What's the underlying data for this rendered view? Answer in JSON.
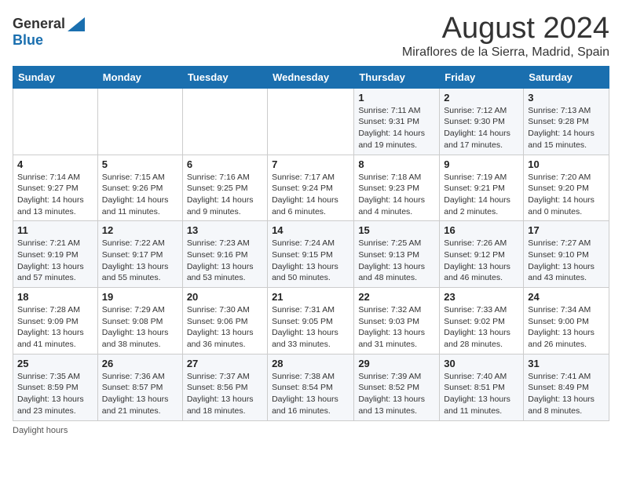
{
  "header": {
    "logo_general": "General",
    "logo_blue": "Blue",
    "main_title": "August 2024",
    "subtitle": "Miraflores de la Sierra, Madrid, Spain"
  },
  "columns": [
    "Sunday",
    "Monday",
    "Tuesday",
    "Wednesday",
    "Thursday",
    "Friday",
    "Saturday"
  ],
  "weeks": [
    [
      {
        "day": "",
        "info": ""
      },
      {
        "day": "",
        "info": ""
      },
      {
        "day": "",
        "info": ""
      },
      {
        "day": "",
        "info": ""
      },
      {
        "day": "1",
        "info": "Sunrise: 7:11 AM\nSunset: 9:31 PM\nDaylight: 14 hours and 19 minutes."
      },
      {
        "day": "2",
        "info": "Sunrise: 7:12 AM\nSunset: 9:30 PM\nDaylight: 14 hours and 17 minutes."
      },
      {
        "day": "3",
        "info": "Sunrise: 7:13 AM\nSunset: 9:28 PM\nDaylight: 14 hours and 15 minutes."
      }
    ],
    [
      {
        "day": "4",
        "info": "Sunrise: 7:14 AM\nSunset: 9:27 PM\nDaylight: 14 hours and 13 minutes."
      },
      {
        "day": "5",
        "info": "Sunrise: 7:15 AM\nSunset: 9:26 PM\nDaylight: 14 hours and 11 minutes."
      },
      {
        "day": "6",
        "info": "Sunrise: 7:16 AM\nSunset: 9:25 PM\nDaylight: 14 hours and 9 minutes."
      },
      {
        "day": "7",
        "info": "Sunrise: 7:17 AM\nSunset: 9:24 PM\nDaylight: 14 hours and 6 minutes."
      },
      {
        "day": "8",
        "info": "Sunrise: 7:18 AM\nSunset: 9:23 PM\nDaylight: 14 hours and 4 minutes."
      },
      {
        "day": "9",
        "info": "Sunrise: 7:19 AM\nSunset: 9:21 PM\nDaylight: 14 hours and 2 minutes."
      },
      {
        "day": "10",
        "info": "Sunrise: 7:20 AM\nSunset: 9:20 PM\nDaylight: 14 hours and 0 minutes."
      }
    ],
    [
      {
        "day": "11",
        "info": "Sunrise: 7:21 AM\nSunset: 9:19 PM\nDaylight: 13 hours and 57 minutes."
      },
      {
        "day": "12",
        "info": "Sunrise: 7:22 AM\nSunset: 9:17 PM\nDaylight: 13 hours and 55 minutes."
      },
      {
        "day": "13",
        "info": "Sunrise: 7:23 AM\nSunset: 9:16 PM\nDaylight: 13 hours and 53 minutes."
      },
      {
        "day": "14",
        "info": "Sunrise: 7:24 AM\nSunset: 9:15 PM\nDaylight: 13 hours and 50 minutes."
      },
      {
        "day": "15",
        "info": "Sunrise: 7:25 AM\nSunset: 9:13 PM\nDaylight: 13 hours and 48 minutes."
      },
      {
        "day": "16",
        "info": "Sunrise: 7:26 AM\nSunset: 9:12 PM\nDaylight: 13 hours and 46 minutes."
      },
      {
        "day": "17",
        "info": "Sunrise: 7:27 AM\nSunset: 9:10 PM\nDaylight: 13 hours and 43 minutes."
      }
    ],
    [
      {
        "day": "18",
        "info": "Sunrise: 7:28 AM\nSunset: 9:09 PM\nDaylight: 13 hours and 41 minutes."
      },
      {
        "day": "19",
        "info": "Sunrise: 7:29 AM\nSunset: 9:08 PM\nDaylight: 13 hours and 38 minutes."
      },
      {
        "day": "20",
        "info": "Sunrise: 7:30 AM\nSunset: 9:06 PM\nDaylight: 13 hours and 36 minutes."
      },
      {
        "day": "21",
        "info": "Sunrise: 7:31 AM\nSunset: 9:05 PM\nDaylight: 13 hours and 33 minutes."
      },
      {
        "day": "22",
        "info": "Sunrise: 7:32 AM\nSunset: 9:03 PM\nDaylight: 13 hours and 31 minutes."
      },
      {
        "day": "23",
        "info": "Sunrise: 7:33 AM\nSunset: 9:02 PM\nDaylight: 13 hours and 28 minutes."
      },
      {
        "day": "24",
        "info": "Sunrise: 7:34 AM\nSunset: 9:00 PM\nDaylight: 13 hours and 26 minutes."
      }
    ],
    [
      {
        "day": "25",
        "info": "Sunrise: 7:35 AM\nSunset: 8:59 PM\nDaylight: 13 hours and 23 minutes."
      },
      {
        "day": "26",
        "info": "Sunrise: 7:36 AM\nSunset: 8:57 PM\nDaylight: 13 hours and 21 minutes."
      },
      {
        "day": "27",
        "info": "Sunrise: 7:37 AM\nSunset: 8:56 PM\nDaylight: 13 hours and 18 minutes."
      },
      {
        "day": "28",
        "info": "Sunrise: 7:38 AM\nSunset: 8:54 PM\nDaylight: 13 hours and 16 minutes."
      },
      {
        "day": "29",
        "info": "Sunrise: 7:39 AM\nSunset: 8:52 PM\nDaylight: 13 hours and 13 minutes."
      },
      {
        "day": "30",
        "info": "Sunrise: 7:40 AM\nSunset: 8:51 PM\nDaylight: 13 hours and 11 minutes."
      },
      {
        "day": "31",
        "info": "Sunrise: 7:41 AM\nSunset: 8:49 PM\nDaylight: 13 hours and 8 minutes."
      }
    ]
  ],
  "footer": {
    "note": "Daylight hours"
  },
  "colors": {
    "header_bg": "#1a6faf",
    "accent": "#1a6faf"
  }
}
